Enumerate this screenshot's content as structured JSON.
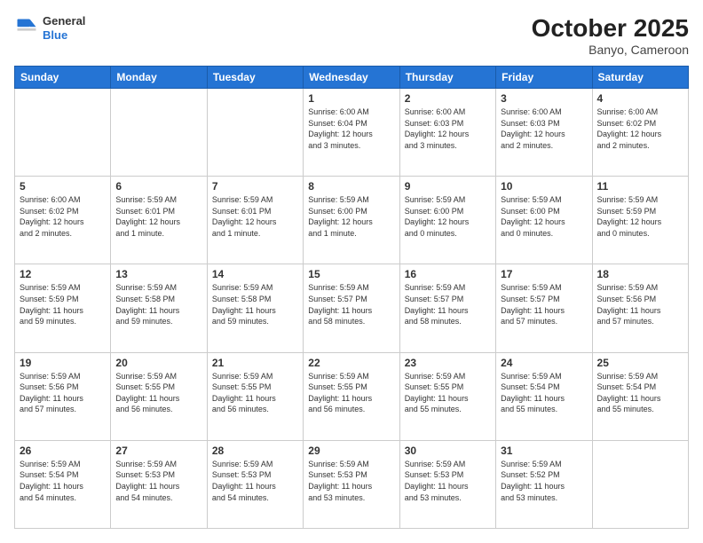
{
  "header": {
    "logo": {
      "general": "General",
      "blue": "Blue"
    },
    "title": "October 2025",
    "subtitle": "Banyo, Cameroon"
  },
  "weekdays": [
    "Sunday",
    "Monday",
    "Tuesday",
    "Wednesday",
    "Thursday",
    "Friday",
    "Saturday"
  ],
  "weeks": [
    [
      {
        "day": "",
        "info": ""
      },
      {
        "day": "",
        "info": ""
      },
      {
        "day": "",
        "info": ""
      },
      {
        "day": "1",
        "info": "Sunrise: 6:00 AM\nSunset: 6:04 PM\nDaylight: 12 hours\nand 3 minutes."
      },
      {
        "day": "2",
        "info": "Sunrise: 6:00 AM\nSunset: 6:03 PM\nDaylight: 12 hours\nand 3 minutes."
      },
      {
        "day": "3",
        "info": "Sunrise: 6:00 AM\nSunset: 6:03 PM\nDaylight: 12 hours\nand 2 minutes."
      },
      {
        "day": "4",
        "info": "Sunrise: 6:00 AM\nSunset: 6:02 PM\nDaylight: 12 hours\nand 2 minutes."
      }
    ],
    [
      {
        "day": "5",
        "info": "Sunrise: 6:00 AM\nSunset: 6:02 PM\nDaylight: 12 hours\nand 2 minutes."
      },
      {
        "day": "6",
        "info": "Sunrise: 5:59 AM\nSunset: 6:01 PM\nDaylight: 12 hours\nand 1 minute."
      },
      {
        "day": "7",
        "info": "Sunrise: 5:59 AM\nSunset: 6:01 PM\nDaylight: 12 hours\nand 1 minute."
      },
      {
        "day": "8",
        "info": "Sunrise: 5:59 AM\nSunset: 6:00 PM\nDaylight: 12 hours\nand 1 minute."
      },
      {
        "day": "9",
        "info": "Sunrise: 5:59 AM\nSunset: 6:00 PM\nDaylight: 12 hours\nand 0 minutes."
      },
      {
        "day": "10",
        "info": "Sunrise: 5:59 AM\nSunset: 6:00 PM\nDaylight: 12 hours\nand 0 minutes."
      },
      {
        "day": "11",
        "info": "Sunrise: 5:59 AM\nSunset: 5:59 PM\nDaylight: 12 hours\nand 0 minutes."
      }
    ],
    [
      {
        "day": "12",
        "info": "Sunrise: 5:59 AM\nSunset: 5:59 PM\nDaylight: 11 hours\nand 59 minutes."
      },
      {
        "day": "13",
        "info": "Sunrise: 5:59 AM\nSunset: 5:58 PM\nDaylight: 11 hours\nand 59 minutes."
      },
      {
        "day": "14",
        "info": "Sunrise: 5:59 AM\nSunset: 5:58 PM\nDaylight: 11 hours\nand 59 minutes."
      },
      {
        "day": "15",
        "info": "Sunrise: 5:59 AM\nSunset: 5:57 PM\nDaylight: 11 hours\nand 58 minutes."
      },
      {
        "day": "16",
        "info": "Sunrise: 5:59 AM\nSunset: 5:57 PM\nDaylight: 11 hours\nand 58 minutes."
      },
      {
        "day": "17",
        "info": "Sunrise: 5:59 AM\nSunset: 5:57 PM\nDaylight: 11 hours\nand 57 minutes."
      },
      {
        "day": "18",
        "info": "Sunrise: 5:59 AM\nSunset: 5:56 PM\nDaylight: 11 hours\nand 57 minutes."
      }
    ],
    [
      {
        "day": "19",
        "info": "Sunrise: 5:59 AM\nSunset: 5:56 PM\nDaylight: 11 hours\nand 57 minutes."
      },
      {
        "day": "20",
        "info": "Sunrise: 5:59 AM\nSunset: 5:55 PM\nDaylight: 11 hours\nand 56 minutes."
      },
      {
        "day": "21",
        "info": "Sunrise: 5:59 AM\nSunset: 5:55 PM\nDaylight: 11 hours\nand 56 minutes."
      },
      {
        "day": "22",
        "info": "Sunrise: 5:59 AM\nSunset: 5:55 PM\nDaylight: 11 hours\nand 56 minutes."
      },
      {
        "day": "23",
        "info": "Sunrise: 5:59 AM\nSunset: 5:55 PM\nDaylight: 11 hours\nand 55 minutes."
      },
      {
        "day": "24",
        "info": "Sunrise: 5:59 AM\nSunset: 5:54 PM\nDaylight: 11 hours\nand 55 minutes."
      },
      {
        "day": "25",
        "info": "Sunrise: 5:59 AM\nSunset: 5:54 PM\nDaylight: 11 hours\nand 55 minutes."
      }
    ],
    [
      {
        "day": "26",
        "info": "Sunrise: 5:59 AM\nSunset: 5:54 PM\nDaylight: 11 hours\nand 54 minutes."
      },
      {
        "day": "27",
        "info": "Sunrise: 5:59 AM\nSunset: 5:53 PM\nDaylight: 11 hours\nand 54 minutes."
      },
      {
        "day": "28",
        "info": "Sunrise: 5:59 AM\nSunset: 5:53 PM\nDaylight: 11 hours\nand 54 minutes."
      },
      {
        "day": "29",
        "info": "Sunrise: 5:59 AM\nSunset: 5:53 PM\nDaylight: 11 hours\nand 53 minutes."
      },
      {
        "day": "30",
        "info": "Sunrise: 5:59 AM\nSunset: 5:53 PM\nDaylight: 11 hours\nand 53 minutes."
      },
      {
        "day": "31",
        "info": "Sunrise: 5:59 AM\nSunset: 5:52 PM\nDaylight: 11 hours\nand 53 minutes."
      },
      {
        "day": "",
        "info": ""
      }
    ]
  ]
}
